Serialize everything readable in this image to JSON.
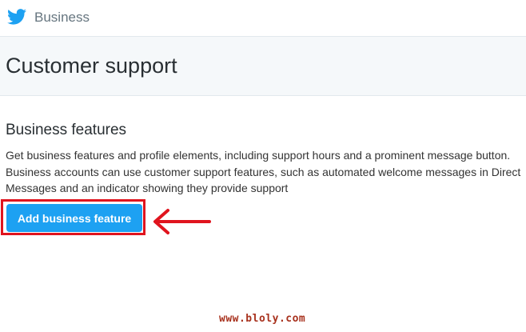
{
  "topbar": {
    "logo_icon": "twitter-bird-icon",
    "brand_label": "Business",
    "accent": "#1da1f2"
  },
  "header": {
    "title": "Customer support"
  },
  "section": {
    "title": "Business features",
    "description": "Get business features and profile elements, including support hours and a prominent message button. Business accounts can use customer support features, such as automated welcome messages in Direct Messages and an indicator showing they provide support",
    "button_label": "Add business feature"
  },
  "annotation": {
    "highlight_color": "#e0141e",
    "arrow_icon": "left-arrow-icon"
  },
  "watermark": "www.bloly.com"
}
